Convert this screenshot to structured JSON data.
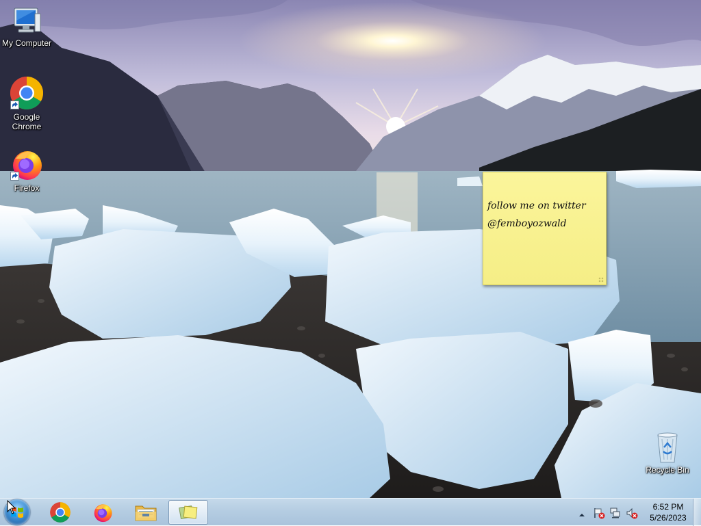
{
  "desktop": {
    "icons": [
      {
        "label": "My Computer",
        "icon": "computer-icon"
      },
      {
        "label": "Google Chrome",
        "icon": "chrome-icon"
      },
      {
        "label": "Firefox",
        "icon": "firefox-icon"
      },
      {
        "label": "Recycle Bin",
        "icon": "recycle-bin-icon"
      }
    ]
  },
  "sticky_note": {
    "text": "follow me on twitter\n@femboyozwald",
    "color": "#f8f18f"
  },
  "taskbar": {
    "pinned": [
      {
        "name": "start-button",
        "icon": "windows-logo-icon"
      },
      {
        "name": "chrome",
        "icon": "chrome-icon"
      },
      {
        "name": "firefox",
        "icon": "firefox-icon"
      },
      {
        "name": "file-explorer",
        "icon": "folder-icon"
      },
      {
        "name": "sticky-notes",
        "icon": "sticky-notes-icon",
        "active": true
      }
    ],
    "tray": {
      "icons": [
        "show-hidden-icons-chevron",
        "action-center-flag-icon",
        "network-icon",
        "volume-muted-icon"
      ],
      "time": "6:52 PM",
      "date": "5/26/2023"
    }
  },
  "colors": {
    "taskbar": "#b5cde2",
    "sticky": "#f8f18f"
  }
}
